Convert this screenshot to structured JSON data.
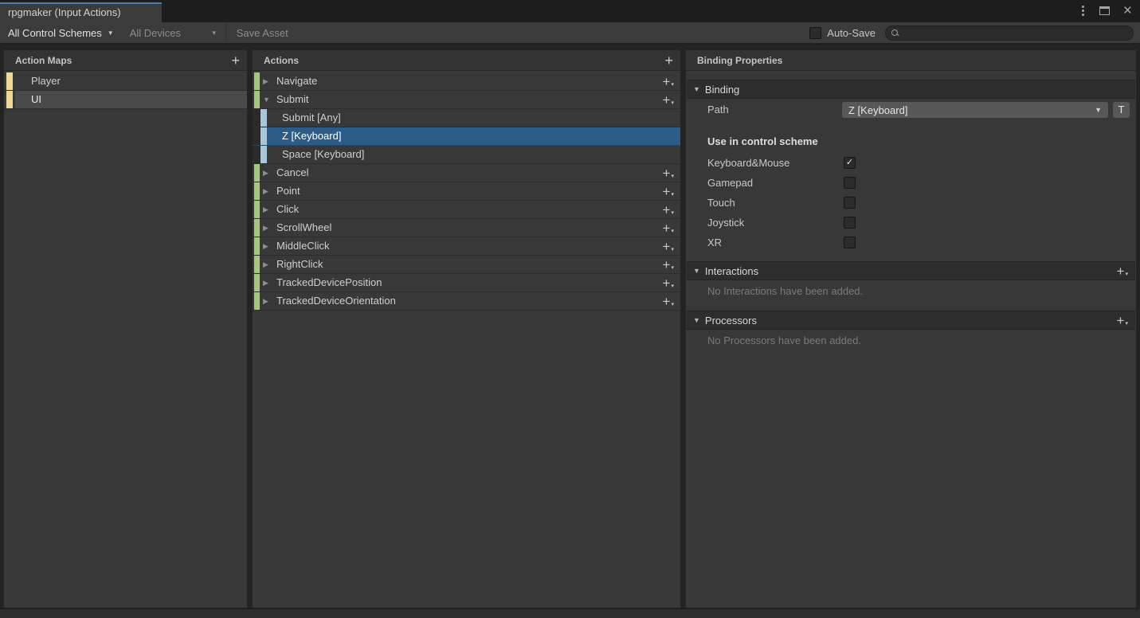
{
  "window": {
    "tab_title": "rpgmaker (Input Actions)"
  },
  "toolbar": {
    "control_schemes": "All Control Schemes",
    "devices": "All Devices",
    "save_asset": "Save Asset",
    "auto_save_label": "Auto-Save",
    "auto_save_checked": false,
    "search_value": ""
  },
  "action_maps": {
    "title": "Action Maps",
    "items": [
      {
        "label": "Player",
        "selected": false
      },
      {
        "label": "UI",
        "selected": true
      }
    ]
  },
  "actions": {
    "title": "Actions",
    "items": [
      {
        "label": "Navigate",
        "type": "action",
        "expanded": false,
        "selected": false
      },
      {
        "label": "Submit",
        "type": "action",
        "expanded": true,
        "selected": false
      },
      {
        "label": "Submit [Any]",
        "type": "binding",
        "selected": false
      },
      {
        "label": "Z [Keyboard]",
        "type": "binding",
        "selected": true
      },
      {
        "label": "Space [Keyboard]",
        "type": "binding",
        "selected": false
      },
      {
        "label": "Cancel",
        "type": "action",
        "expanded": false,
        "selected": false
      },
      {
        "label": "Point",
        "type": "action",
        "expanded": false,
        "selected": false
      },
      {
        "label": "Click",
        "type": "action",
        "expanded": false,
        "selected": false
      },
      {
        "label": "ScrollWheel",
        "type": "action",
        "expanded": false,
        "selected": false
      },
      {
        "label": "MiddleClick",
        "type": "action",
        "expanded": false,
        "selected": false
      },
      {
        "label": "RightClick",
        "type": "action",
        "expanded": false,
        "selected": false
      },
      {
        "label": "TrackedDevicePosition",
        "type": "action",
        "expanded": false,
        "selected": false
      },
      {
        "label": "TrackedDeviceOrientation",
        "type": "action",
        "expanded": false,
        "selected": false
      }
    ]
  },
  "binding_properties": {
    "title": "Binding Properties",
    "binding_section": "Binding",
    "path_label": "Path",
    "path_value": "Z [Keyboard]",
    "text_button": "T",
    "control_scheme_label": "Use in control scheme",
    "schemes": [
      {
        "label": "Keyboard&Mouse",
        "checked": true
      },
      {
        "label": "Gamepad",
        "checked": false
      },
      {
        "label": "Touch",
        "checked": false
      },
      {
        "label": "Joystick",
        "checked": false
      },
      {
        "label": "XR",
        "checked": false
      }
    ],
    "interactions_section": "Interactions",
    "interactions_empty": "No Interactions have been added.",
    "processors_section": "Processors",
    "processors_empty": "No Processors have been added."
  },
  "icons": {
    "plus": "+",
    "caret_down": "▾",
    "dropdown_caret": "▼",
    "tri_right": "▶",
    "tri_down": "▼",
    "check": "✓",
    "close": "×"
  },
  "colors": {
    "tab_accent_blue": "#4C7CAF",
    "selection_blue": "#2B5C87",
    "action_bar_green": "#A2C878",
    "binding_bar_blue": "#A9C7DB",
    "map_bar_yellow": "#EFD795"
  }
}
